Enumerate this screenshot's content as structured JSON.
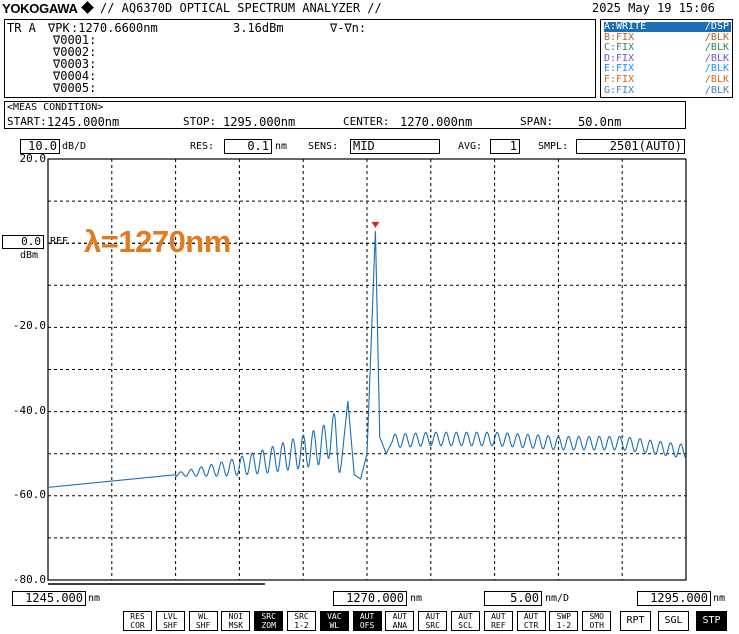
{
  "header": {
    "brand": "YOKOGAWA",
    "title": "// AQ6370D OPTICAL SPECTRUM ANALYZER //",
    "datetime": "2025 May 19 15:06"
  },
  "markers": {
    "head_tr": "TR A",
    "head_label": "∇PK",
    "head_wavelength": ":1270.6600nm",
    "head_power": "3.16dBm",
    "head_delta": "∇-∇n:",
    "rows": [
      "∇0001:",
      "∇0002:",
      "∇0003:",
      "∇0004:",
      "∇0005:"
    ]
  },
  "traces": [
    {
      "name": "A:WRITE",
      "mode": "/DSP",
      "color": "#1a6fb5",
      "active": true
    },
    {
      "name": "B:FIX",
      "mode": "/BLK",
      "color": "#b5651d",
      "active": false
    },
    {
      "name": "C:FIX",
      "mode": "/BLK",
      "color": "#2e8b57",
      "active": false
    },
    {
      "name": "D:FIX",
      "mode": "/BLK",
      "color": "#6a5acd",
      "active": false
    },
    {
      "name": "E:FIX",
      "mode": "/BLK",
      "color": "#1e90ff",
      "active": false
    },
    {
      "name": "F:FIX",
      "mode": "/BLK",
      "color": "#d2691e",
      "active": false
    },
    {
      "name": "G:FIX",
      "mode": "/BLK",
      "color": "#4682b4",
      "active": false
    }
  ],
  "meas": {
    "title": "<MEAS CONDITION>",
    "start_label": "START:",
    "start_value": "1245.000nm",
    "stop_label": "STOP:",
    "stop_value": "1295.000nm",
    "center_label": "CENTER:",
    "center_value": "1270.000nm",
    "span_label": "SPAN:",
    "span_value": "50.0nm"
  },
  "settings": {
    "scale_value": "10.0",
    "scale_unit": "dB/D",
    "res_label": "RES:",
    "res_value": "0.1",
    "res_unit": "nm",
    "sens_label": "SENS:",
    "sens_value": "MID",
    "avg_label": "AVG:",
    "avg_value": "1",
    "smpl_label": "SMPL:",
    "smpl_value": "2501(AUTO)"
  },
  "ref": {
    "value": "0.0",
    "label": "REF",
    "unit": "dBm"
  },
  "yticks": [
    "20.0",
    "-20.0",
    "-40.0",
    "-60.0",
    "-80.0"
  ],
  "xaxis": {
    "start_value": "1245.000",
    "start_unit": "nm",
    "center_value": "1270.000",
    "center_unit": "nm",
    "div_value": "5.00",
    "div_unit": "nm/D",
    "stop_value": "1295.000",
    "stop_unit": "nm"
  },
  "annotation": "λ=1270nm",
  "softkeys": [
    {
      "top": "RES",
      "bottom": "COR",
      "on": false
    },
    {
      "top": "LVL",
      "bottom": "SHF",
      "on": false
    },
    {
      "top": "WL",
      "bottom": "SHF",
      "on": false
    },
    {
      "top": "NOI",
      "bottom": "MSK",
      "on": false
    },
    {
      "top": "SRC",
      "bottom": "ZOM",
      "on": true
    },
    {
      "top": "SRC",
      "bottom": "1-2",
      "on": false
    },
    {
      "top": "VAC",
      "bottom": "WL",
      "on": true
    },
    {
      "top": "AUT",
      "bottom": "OFS",
      "on": true
    },
    {
      "top": "AUT",
      "bottom": "ANA",
      "on": false
    },
    {
      "top": "AUT",
      "bottom": "SRC",
      "on": false
    },
    {
      "top": "AUT",
      "bottom": "SCL",
      "on": false
    },
    {
      "top": "AUT",
      "bottom": "REF",
      "on": false
    },
    {
      "top": "AUT",
      "bottom": "CTR",
      "on": false
    },
    {
      "top": "SWP",
      "bottom": "1-2",
      "on": false
    },
    {
      "top": "SMO",
      "bottom": "OTH",
      "on": false
    }
  ],
  "buttons": {
    "rpt": "RPT",
    "sgl": "SGL",
    "stp": "STP"
  },
  "chart_data": {
    "type": "line",
    "xlabel": "",
    "ylabel": "",
    "xlim": [
      1245.0,
      1295.0
    ],
    "ylim": [
      -80.0,
      20.0
    ],
    "grid": true,
    "series": [
      {
        "color": "#1a6fb5",
        "x": [
          1245.0,
          1250.0,
          1255.0,
          1259.0,
          1262.0,
          1265.0,
          1266.5,
          1267.5,
          1268.0,
          1268.5,
          1269.0,
          1269.5,
          1270.0,
          1270.66,
          1271.0,
          1271.5,
          1272.0,
          1275.0,
          1280.0,
          1285.0,
          1290.0,
          1295.0
        ],
        "y": [
          -58.0,
          -56.5,
          -55.0,
          -53.5,
          -51.8,
          -49.5,
          -48.0,
          -45.0,
          -52.0,
          -37.5,
          -55.0,
          -56.0,
          -50.0,
          3.16,
          -46.0,
          -50.0,
          -47.0,
          -46.5,
          -46.5,
          -47.5,
          -47.5,
          -49.5
        ]
      }
    ],
    "peak_marker": {
      "x": 1270.66,
      "y": 3.16
    }
  }
}
